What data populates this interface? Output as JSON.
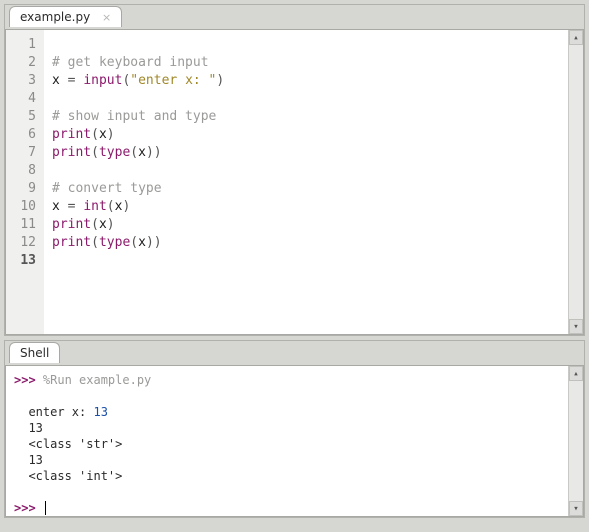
{
  "editor": {
    "tab_label": "example.py",
    "lines": [
      {
        "n": 1,
        "tokens": []
      },
      {
        "n": 2,
        "tokens": [
          {
            "t": "# get keyboard input",
            "c": "comment"
          }
        ]
      },
      {
        "n": 3,
        "tokens": [
          {
            "t": "x ",
            "c": "ident"
          },
          {
            "t": "=",
            "c": "op"
          },
          {
            "t": " ",
            "c": "ident"
          },
          {
            "t": "input",
            "c": "builtin"
          },
          {
            "t": "(",
            "c": "paren"
          },
          {
            "t": "\"enter x: \"",
            "c": "string"
          },
          {
            "t": ")",
            "c": "paren"
          }
        ]
      },
      {
        "n": 4,
        "tokens": []
      },
      {
        "n": 5,
        "tokens": [
          {
            "t": "# show input and type",
            "c": "comment"
          }
        ]
      },
      {
        "n": 6,
        "tokens": [
          {
            "t": "print",
            "c": "builtin"
          },
          {
            "t": "(",
            "c": "paren"
          },
          {
            "t": "x",
            "c": "ident"
          },
          {
            "t": ")",
            "c": "paren"
          }
        ]
      },
      {
        "n": 7,
        "tokens": [
          {
            "t": "print",
            "c": "builtin"
          },
          {
            "t": "(",
            "c": "paren"
          },
          {
            "t": "type",
            "c": "builtin"
          },
          {
            "t": "(",
            "c": "paren"
          },
          {
            "t": "x",
            "c": "ident"
          },
          {
            "t": ")",
            "c": "paren"
          },
          {
            "t": ")",
            "c": "paren"
          }
        ]
      },
      {
        "n": 8,
        "tokens": []
      },
      {
        "n": 9,
        "tokens": [
          {
            "t": "# convert type",
            "c": "comment"
          }
        ]
      },
      {
        "n": 10,
        "tokens": [
          {
            "t": "x ",
            "c": "ident"
          },
          {
            "t": "=",
            "c": "op"
          },
          {
            "t": " ",
            "c": "ident"
          },
          {
            "t": "int",
            "c": "builtin"
          },
          {
            "t": "(",
            "c": "paren"
          },
          {
            "t": "x",
            "c": "ident"
          },
          {
            "t": ")",
            "c": "paren"
          }
        ]
      },
      {
        "n": 11,
        "tokens": [
          {
            "t": "print",
            "c": "builtin"
          },
          {
            "t": "(",
            "c": "paren"
          },
          {
            "t": "x",
            "c": "ident"
          },
          {
            "t": ")",
            "c": "paren"
          }
        ]
      },
      {
        "n": 12,
        "tokens": [
          {
            "t": "print",
            "c": "builtin"
          },
          {
            "t": "(",
            "c": "paren"
          },
          {
            "t": "type",
            "c": "builtin"
          },
          {
            "t": "(",
            "c": "paren"
          },
          {
            "t": "x",
            "c": "ident"
          },
          {
            "t": ")",
            "c": "paren"
          },
          {
            "t": ")",
            "c": "paren"
          }
        ]
      },
      {
        "n": 13,
        "tokens": [],
        "current": true
      }
    ]
  },
  "shell": {
    "tab_label": "Shell",
    "prompt": ">>>",
    "run_cmd": "%Run example.py",
    "output": [
      {
        "kind": "input_prompt",
        "label": "enter x: ",
        "value": "13"
      },
      {
        "kind": "text",
        "text": "13"
      },
      {
        "kind": "text",
        "text": "<class 'str'>"
      },
      {
        "kind": "text",
        "text": "13"
      },
      {
        "kind": "text",
        "text": "<class 'int'>"
      }
    ]
  }
}
